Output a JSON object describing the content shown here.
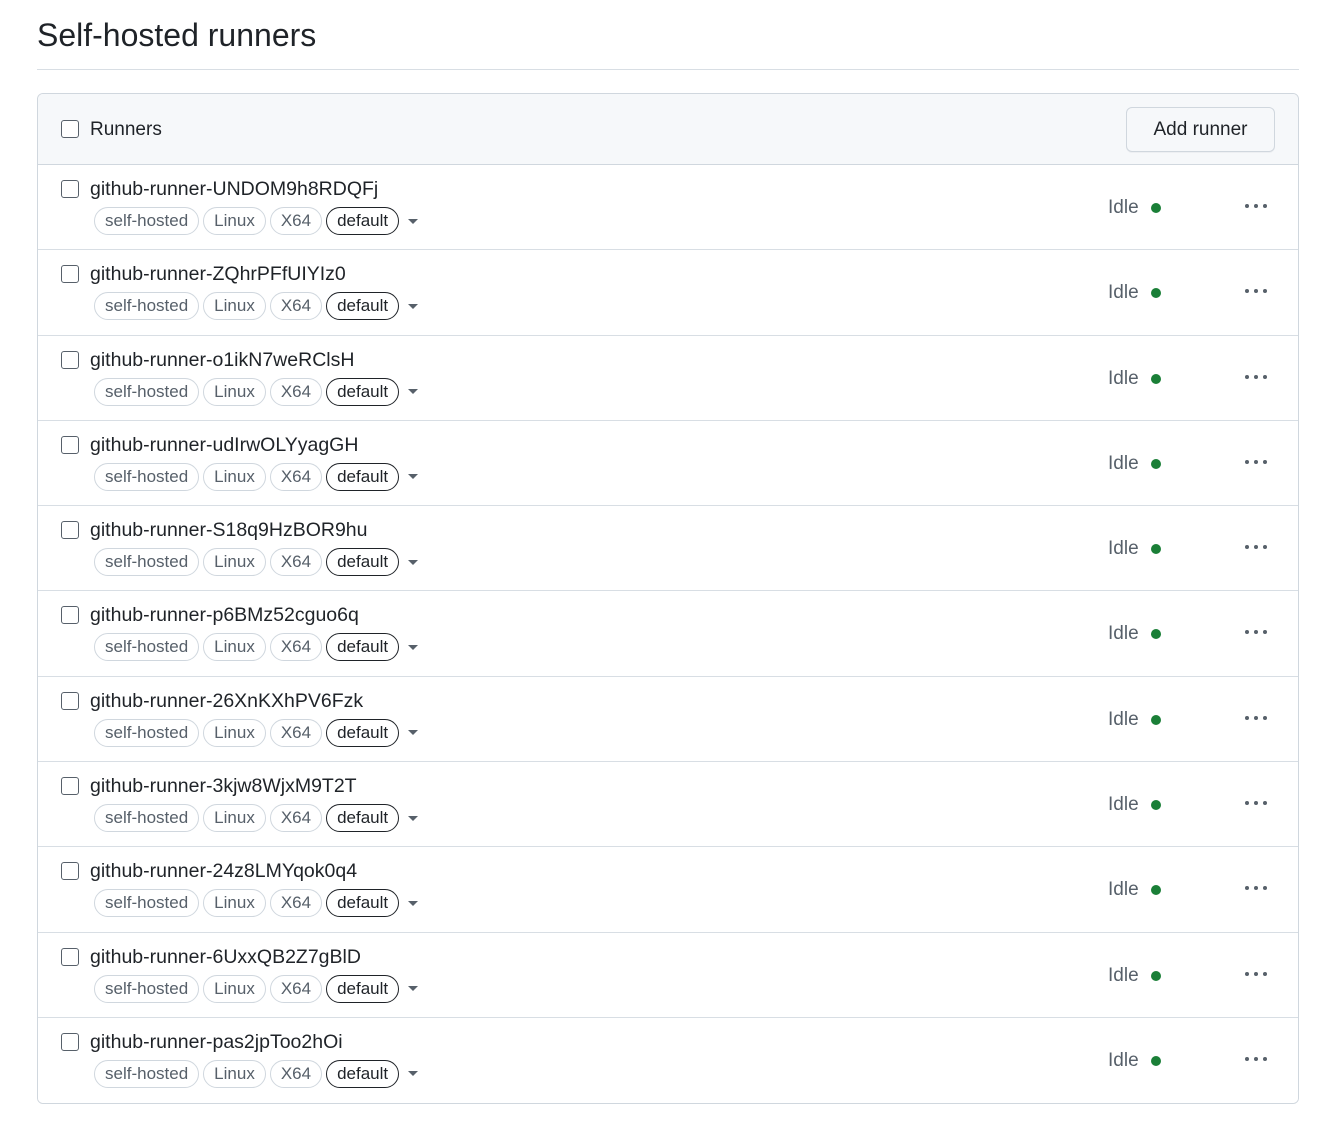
{
  "page": {
    "title": "Self-hosted runners"
  },
  "panel": {
    "header_label": "Runners",
    "add_runner_label": "Add runner"
  },
  "colors": {
    "idle_dot": "#1a7f37"
  },
  "runners": [
    {
      "name": "github-runner-UNDOM9h8RDQFj",
      "labels": [
        "self-hosted",
        "Linux",
        "X64"
      ],
      "group": "default",
      "status": "Idle"
    },
    {
      "name": "github-runner-ZQhrPFfUIYIz0",
      "labels": [
        "self-hosted",
        "Linux",
        "X64"
      ],
      "group": "default",
      "status": "Idle"
    },
    {
      "name": "github-runner-o1ikN7weRClsH",
      "labels": [
        "self-hosted",
        "Linux",
        "X64"
      ],
      "group": "default",
      "status": "Idle"
    },
    {
      "name": "github-runner-udIrwOLYyagGH",
      "labels": [
        "self-hosted",
        "Linux",
        "X64"
      ],
      "group": "default",
      "status": "Idle"
    },
    {
      "name": "github-runner-S18q9HzBOR9hu",
      "labels": [
        "self-hosted",
        "Linux",
        "X64"
      ],
      "group": "default",
      "status": "Idle"
    },
    {
      "name": "github-runner-p6BMz52cguo6q",
      "labels": [
        "self-hosted",
        "Linux",
        "X64"
      ],
      "group": "default",
      "status": "Idle"
    },
    {
      "name": "github-runner-26XnKXhPV6Fzk",
      "labels": [
        "self-hosted",
        "Linux",
        "X64"
      ],
      "group": "default",
      "status": "Idle"
    },
    {
      "name": "github-runner-3kjw8WjxM9T2T",
      "labels": [
        "self-hosted",
        "Linux",
        "X64"
      ],
      "group": "default",
      "status": "Idle"
    },
    {
      "name": "github-runner-24z8LMYqok0q4",
      "labels": [
        "self-hosted",
        "Linux",
        "X64"
      ],
      "group": "default",
      "status": "Idle"
    },
    {
      "name": "github-runner-6UxxQB2Z7gBlD",
      "labels": [
        "self-hosted",
        "Linux",
        "X64"
      ],
      "group": "default",
      "status": "Idle"
    },
    {
      "name": "github-runner-pas2jpToo2hOi",
      "labels": [
        "self-hosted",
        "Linux",
        "X64"
      ],
      "group": "default",
      "status": "Idle"
    }
  ]
}
